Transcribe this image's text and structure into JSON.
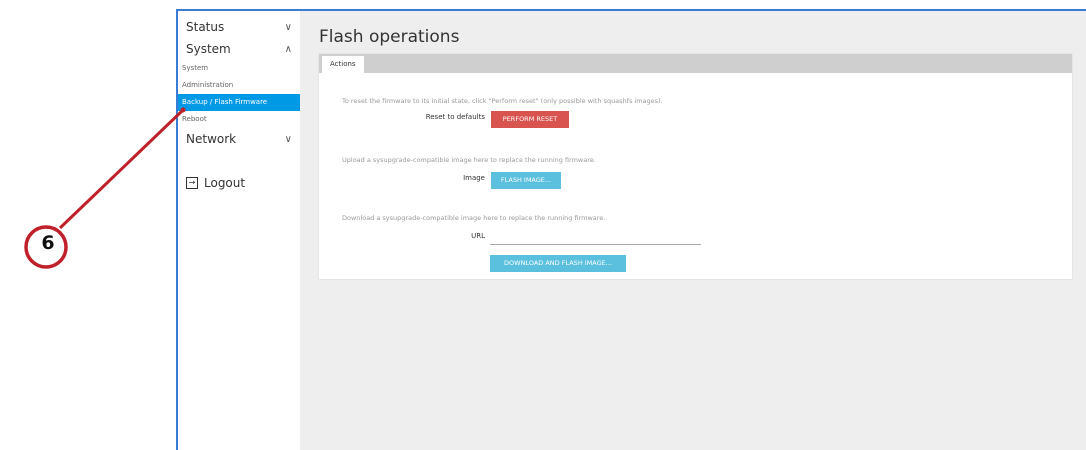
{
  "sidebar": {
    "status": {
      "label": "Status",
      "chevron": "chevron-down-icon"
    },
    "system": {
      "label": "System",
      "chevron": "chevron-up-icon",
      "items": [
        {
          "label": "System"
        },
        {
          "label": "Administration"
        },
        {
          "label": "Backup / Flash Firmware",
          "active": true
        },
        {
          "label": "Reboot"
        }
      ]
    },
    "network": {
      "label": "Network",
      "chevron": "chevron-down-icon"
    },
    "logout": {
      "label": "Logout",
      "icon": "logout-icon"
    }
  },
  "main": {
    "title": "Flash operations",
    "tabs": [
      {
        "label": "Actions"
      }
    ],
    "reset": {
      "description": "To reset the firmware to its initial state, click \"Perform reset\" (only possible with squashfs images).",
      "label": "Reset to defaults",
      "button": "PERFORM RESET"
    },
    "upload": {
      "description": "Upload a sysupgrade-compatible image here to replace the running firmware.",
      "label": "Image",
      "button": "FLASH IMAGE..."
    },
    "download": {
      "description": "Download a sysupgrade-compatible image here to replace the running firmware.",
      "label": "URL",
      "url_value": "",
      "button": "DOWNLOAD AND FLASH IMAGE..."
    }
  },
  "annotation": {
    "number": "6",
    "color": "#c0202a"
  },
  "colors": {
    "accent": "#0099e6",
    "danger": "#d9534f",
    "info": "#5bc0de",
    "frame": "#3a7bd5"
  }
}
